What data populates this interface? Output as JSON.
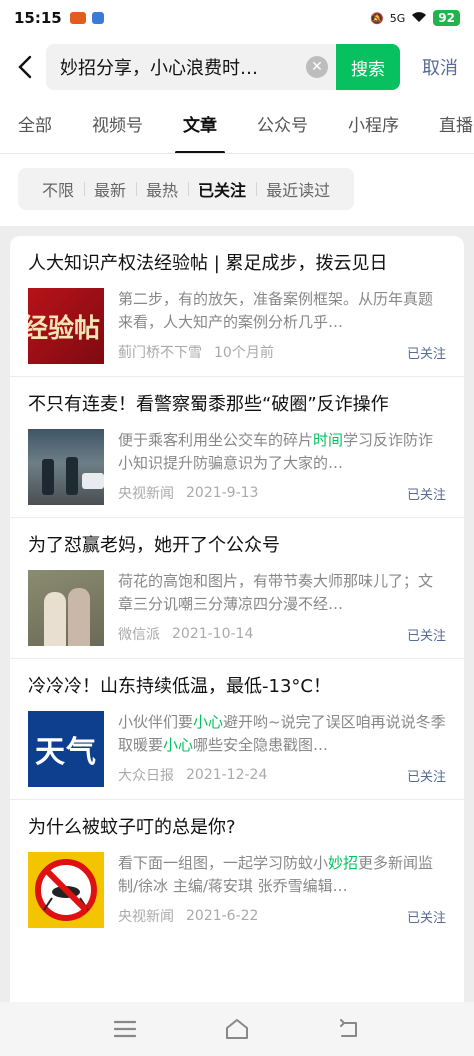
{
  "status": {
    "time": "15:15",
    "network": "5G",
    "battery": "92"
  },
  "search": {
    "query": "妙招分享，小心浪费时…",
    "submit_label": "搜索",
    "cancel_label": "取消"
  },
  "tabs": [
    {
      "label": "全部"
    },
    {
      "label": "视频号"
    },
    {
      "label": "文章"
    },
    {
      "label": "公众号"
    },
    {
      "label": "小程序"
    },
    {
      "label": "直播"
    }
  ],
  "filters": [
    {
      "label": "不限"
    },
    {
      "label": "最新"
    },
    {
      "label": "最热"
    },
    {
      "label": "已关注"
    },
    {
      "label": "最近读过"
    }
  ],
  "articles": [
    {
      "title": "人大知识产权法经验帖 | 累足成步，拨云见日",
      "desc_parts": [
        "第二步，有的放矢，准备案例框架。从历年真题来看，人大知产的案例分析几乎…"
      ],
      "source": "蓟门桥不下雪",
      "date": "10个月前",
      "status": "已关注",
      "thumb_text": "经验帖"
    },
    {
      "title": "不只有连麦！看警察蜀黍那些“破圈”反诈操作",
      "desc_parts": [
        "便于乘客利用坐公交车的碎片",
        "时间",
        "学习反诈防诈小知识提升防骗意识为了大家的…"
      ],
      "source": "央视新闻",
      "date": "2021-9-13",
      "status": "已关注"
    },
    {
      "title": "为了怼赢老妈，她开了个公众号",
      "desc_parts": [
        "荷花的高饱和图片，有带节奏大师那味儿了；文章三分讥嘲三分薄凉四分漫不经…"
      ],
      "source": "微信派",
      "date": "2021-10-14",
      "status": "已关注"
    },
    {
      "title": "冷冷冷！山东持续低温，最低-13°C！",
      "desc_parts": [
        "小伙伴们要",
        "小心",
        "避开哟~说完了误区咱再说说冬季取暖要",
        "小心",
        "哪些安全隐患戳图…"
      ],
      "source": "大众日报",
      "date": "2021-12-24",
      "status": "已关注",
      "thumb_text": "天气"
    },
    {
      "title": "为什么被蚊子叮的总是你?",
      "desc_parts": [
        "看下面一组图，一起学习防蚊小",
        "妙招",
        "更多新闻监制/徐冰 主编/蒋安琪 张乔雪编辑…"
      ],
      "source": "央视新闻",
      "date": "2021-6-22",
      "status": "已关注"
    }
  ],
  "colors": {
    "accent": "#07c160",
    "link": "#576b95"
  }
}
